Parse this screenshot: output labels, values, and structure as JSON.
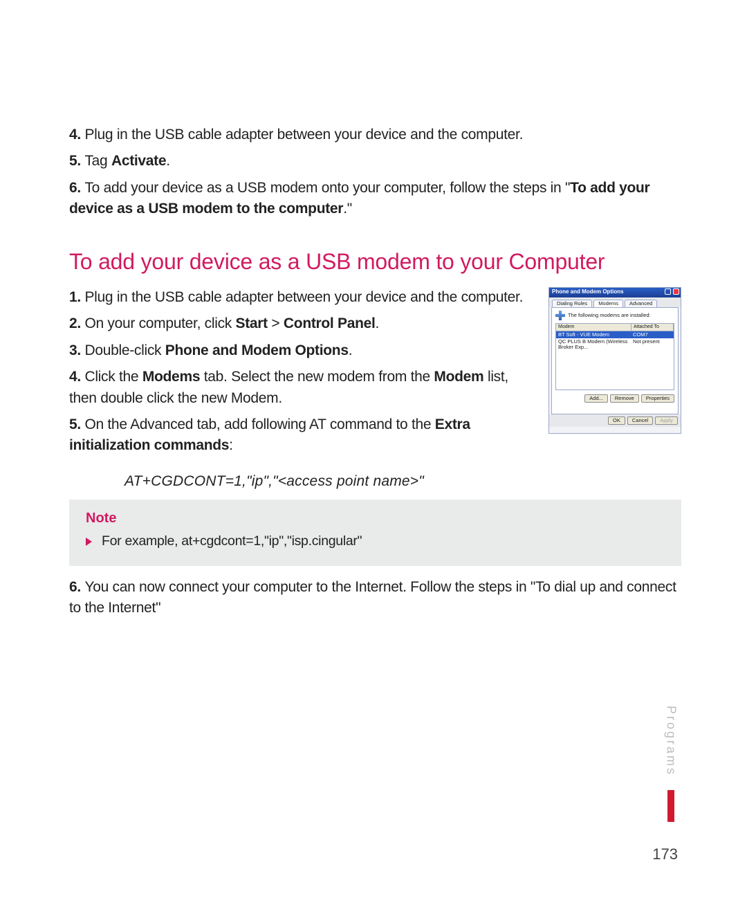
{
  "top_list": [
    {
      "num": "4.",
      "parts": [
        {
          "t": "Plug in the USB cable adapter between your device and the computer.",
          "b": false
        }
      ]
    },
    {
      "num": "5.",
      "parts": [
        {
          "t": "Tag ",
          "b": false
        },
        {
          "t": "Activate",
          "b": true
        },
        {
          "t": ".",
          "b": false
        }
      ]
    },
    {
      "num": "6.",
      "parts": [
        {
          "t": "To add your device as a USB modem onto your computer, follow the steps in \"",
          "b": false
        },
        {
          "t": "To add your device as a USB modem to the computer",
          "b": true
        },
        {
          "t": ".\"",
          "b": false
        }
      ]
    }
  ],
  "section_title": "To add your device as a USB modem to your Computer",
  "steps": [
    {
      "num": "1.",
      "parts": [
        {
          "t": "Plug in the USB cable adapter between your device and the computer.",
          "b": false
        }
      ]
    },
    {
      "num": "2.",
      "parts": [
        {
          "t": "On your computer, click ",
          "b": false
        },
        {
          "t": "Start",
          "b": true
        },
        {
          "t": " > ",
          "b": false
        },
        {
          "t": "Control Panel",
          "b": true
        },
        {
          "t": ".",
          "b": false
        }
      ]
    },
    {
      "num": "3.",
      "parts": [
        {
          "t": "Double-click ",
          "b": false
        },
        {
          "t": "Phone and Modem Options",
          "b": true
        },
        {
          "t": ".",
          "b": false
        }
      ]
    },
    {
      "num": "4.",
      "parts": [
        {
          "t": "Click the ",
          "b": false
        },
        {
          "t": "Modems",
          "b": true
        },
        {
          "t": " tab. Select the new modem from the ",
          "b": false
        },
        {
          "t": "Modem",
          "b": true
        },
        {
          "t": " list, then double click the new Modem.",
          "b": false
        }
      ]
    },
    {
      "num": "5.",
      "parts": [
        {
          "t": "On the Advanced tab, add following AT command to the ",
          "b": false
        },
        {
          "t": "Extra initialization commands",
          "b": true
        },
        {
          "t": ":",
          "b": false
        }
      ]
    }
  ],
  "at_command": "AT+CGDCONT=1,\"ip\",\"<access point name>\"",
  "note": {
    "title": "Note",
    "text": "For example, at+cgdcont=1,\"ip\",\"isp.cingular\""
  },
  "after_note": {
    "num": "6.",
    "parts": [
      {
        "t": "You can now connect your computer to the Internet. Follow the steps in \"To dial  up and connect to the Internet\"",
        "b": false
      }
    ]
  },
  "screenshot": {
    "title": "Phone and Modem Options",
    "tabs": [
      "Dialing Rules",
      "Modems",
      "Advanced"
    ],
    "hint": "The following modems are installed:",
    "col1": "Modem",
    "col2": "Attached To",
    "row1_c1": "BT Soft - VUE Modem",
    "row1_c2": "COM7",
    "row2_c1": "QC PLUS B Modem (Wireless Broker Exp...",
    "row2_c2": "Not present",
    "btn_add": "Add...",
    "btn_remove": "Remove",
    "btn_prop": "Properties",
    "btn_ok": "OK",
    "btn_cancel": "Cancel",
    "btn_apply": "Apply"
  },
  "side_label": "Programs",
  "page_number": "173"
}
